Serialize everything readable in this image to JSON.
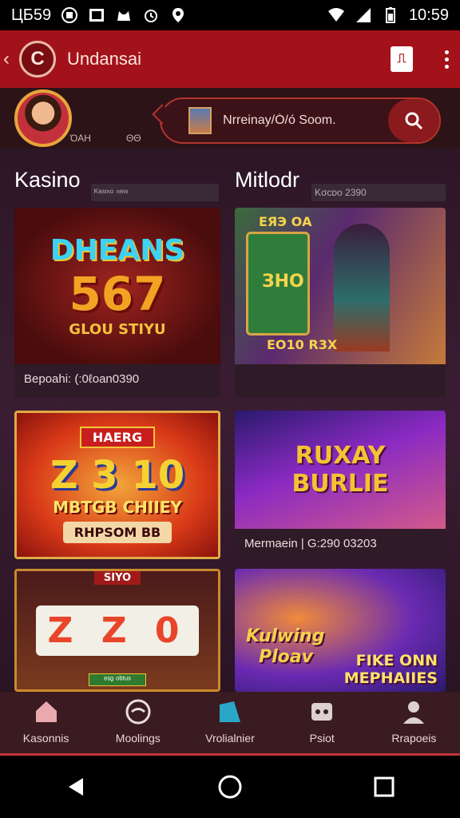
{
  "status_bar": {
    "left_text": "ЦБ59",
    "time": "10:59",
    "icons": [
      "message-icon",
      "gallery-icon",
      "cat-icon",
      "alarm-icon",
      "location-icon",
      "wifi-icon",
      "signal-icon",
      "battery-icon"
    ]
  },
  "app_bar": {
    "logo_letter": "C",
    "title": "Undansai",
    "action_icon": "book-icon",
    "menu_icon": "more-vert-icon"
  },
  "profile": {
    "meta_left": "ΌΑΗ",
    "meta_right": "ΘΘ"
  },
  "search": {
    "value": "Nrreinay/Ó/ó Soom.",
    "icon": "search-icon"
  },
  "sections": {
    "left_title": "Kasino",
    "right_title": "Mitlodr",
    "left_sub": "ᴷᵃˢᶦⁿᵒ ⁿᵉʷ",
    "right_sub": "Kσcᴅo 2390"
  },
  "cards": [
    {
      "line1": "DHEANS",
      "line2": "567",
      "line3": "GLOU STIYU",
      "caption": "Bepoahi: (:0ℓoan0390",
      "colors": [
        "#6e1414",
        "#3b0a0a"
      ]
    },
    {
      "line1": "ЕЯЭ ОА",
      "line2": "ЗНО",
      "line3": "ЕО10 R3X",
      "caption": "",
      "colors": [
        "#5a2a6e",
        "#d88c3a"
      ]
    },
    {
      "line1": "HAERG",
      "line2": "Z 3 10",
      "line3": "MBTGB CHIIEY",
      "line4": "RHPSOM BB",
      "caption": "",
      "colors": [
        "#e2561d",
        "#a81a12"
      ]
    },
    {
      "line1": "RUXAY",
      "line2": "BURLIE",
      "caption": "Mermaein | G:290 03203",
      "colors": [
        "#5b1a8e",
        "#a53bd2"
      ]
    },
    {
      "line1": "SIYO",
      "line2": "Z Z 0",
      "line3": "ᵉˢᵍ ᵒᵇᵗᵘˢ",
      "caption": "",
      "colors": [
        "#4a1618",
        "#b8821e"
      ]
    },
    {
      "line1": "Kulwing",
      "line2": "Ploav",
      "line3": "FIKE ONN",
      "line4": "MEPHAIIES",
      "caption": "",
      "colors": [
        "#3d2a92",
        "#e67b34"
      ]
    }
  ],
  "bottom_nav": [
    {
      "label": "Kasonnis",
      "icon": "home-icon"
    },
    {
      "label": "Moolings",
      "icon": "chat-icon"
    },
    {
      "label": "Vrolialnier",
      "icon": "tag-icon"
    },
    {
      "label": "Psiot",
      "icon": "ticket-icon"
    },
    {
      "label": "Rrapoeis",
      "icon": "user-icon"
    }
  ],
  "colors": {
    "brand": "#a3121a",
    "accent": "#c0313b",
    "background": "#2d1626"
  }
}
